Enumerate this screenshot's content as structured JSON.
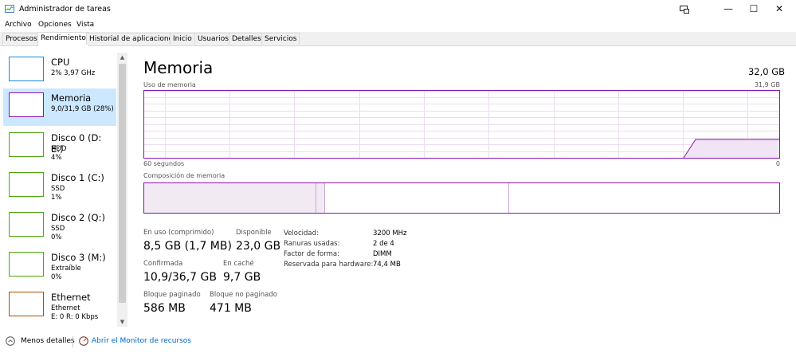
{
  "window": {
    "title": "Administrador de tareas"
  },
  "menu": [
    "Archivo",
    "Opciones",
    "Vista"
  ],
  "tabs": [
    "Procesos",
    "Rendimiento",
    "Historial de aplicaciones",
    "Inicio",
    "Usuarios",
    "Detalles",
    "Servicios"
  ],
  "active_tab": "Rendimiento",
  "sidebar": [
    {
      "title": "CPU",
      "lines": [
        "2%  3,97 GHz"
      ],
      "color": "#1a8ad4"
    },
    {
      "title": "Memoria",
      "lines": [
        "9,0/31,9 GB (28%)"
      ],
      "color": "#8b12ae"
    },
    {
      "title": "Disco 0 (D: E:)",
      "lines": [
        "HDD",
        "4%"
      ],
      "color": "#4da60c"
    },
    {
      "title": "Disco 1 (C:)",
      "lines": [
        "SSD",
        "1%"
      ],
      "color": "#4da60c"
    },
    {
      "title": "Disco 2 (Q:)",
      "lines": [
        "SSD",
        "0%"
      ],
      "color": "#4da60c"
    },
    {
      "title": "Disco 3 (M:)",
      "lines": [
        "Extraíble",
        "0%"
      ],
      "color": "#4da60c"
    },
    {
      "title": "Ethernet",
      "lines": [
        "Ethernet",
        "E: 0  R: 0 Kbps"
      ],
      "color": "#a74f01"
    }
  ],
  "main": {
    "title": "Memoria",
    "total": "32,0 GB",
    "usage_label": "Uso de memoria",
    "usage_max": "31,9 GB",
    "time_label": "60 segundos",
    "time_end": "0",
    "composition_label": "Composición de memoria",
    "accent_color": "#8b12ae"
  },
  "stats": [
    {
      "label": "En uso (comprimido)",
      "value": "8,5 GB (1,7 MB)"
    },
    {
      "label": "Disponible",
      "value": "23,0 GB"
    },
    {
      "label": "Confirmada",
      "value": "10,9/36,7 GB"
    },
    {
      "label": "En caché",
      "value": "9,7 GB"
    },
    {
      "label": "Bloque paginado",
      "value": "586 MB"
    },
    {
      "label": "Bloque no paginado",
      "value": "471 MB"
    }
  ],
  "details": [
    {
      "label": "Velocidad:",
      "value": "3200 MHz"
    },
    {
      "label": "Ranuras usadas:",
      "value": "2 de 4"
    },
    {
      "label": "Factor de forma:",
      "value": "DIMM"
    },
    {
      "label": "Reservada para hardware:",
      "value": "74,4 MB"
    }
  ],
  "footer": {
    "less_details": "Menos detalles",
    "resource_monitor": "Abrir el Monitor de recursos"
  },
  "icons": {
    "less_details": "chevron-up-circle-icon",
    "resource_monitor": "resource-monitor-icon"
  }
}
